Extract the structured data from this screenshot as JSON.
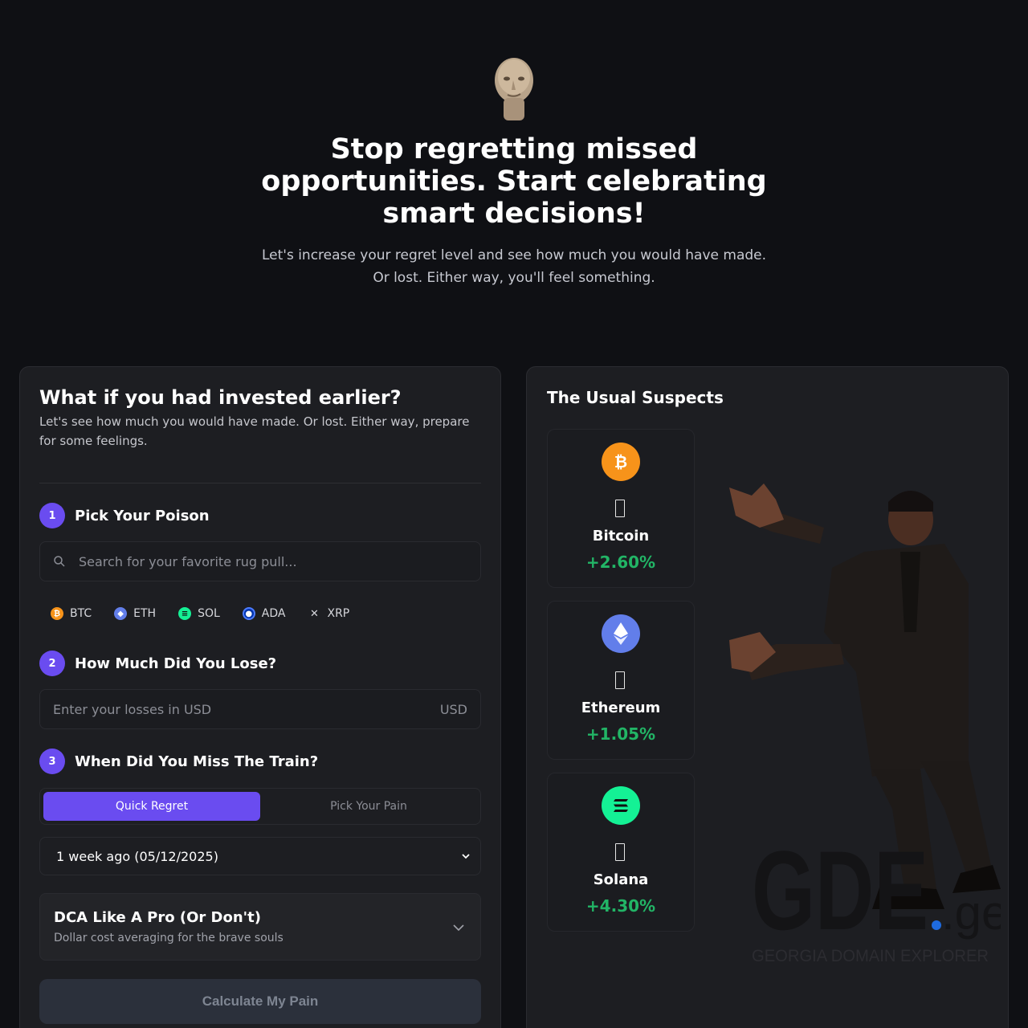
{
  "hero": {
    "title": "Stop regretting missed opportunities. Start celebrating smart decisions!",
    "subtitle": "Let's increase your regret level and see how much you would have made. Or lost. Either way, you'll feel something."
  },
  "form": {
    "title": "What if you had invested earlier?",
    "description": "Let's see how much you would have made. Or lost. Either way, prepare for some feelings.",
    "steps": [
      {
        "number": "1",
        "label": "Pick Your Poison"
      },
      {
        "number": "2",
        "label": "How Much Did You Lose?"
      },
      {
        "number": "3",
        "label": "When Did You Miss The Train?"
      }
    ],
    "search_placeholder": "Search for your favorite rug pull...",
    "coins": [
      {
        "symbol": "BTC",
        "color": "#f7931a"
      },
      {
        "symbol": "ETH",
        "color": "#627eea"
      },
      {
        "symbol": "SOL",
        "color": "#14f195"
      },
      {
        "symbol": "ADA",
        "color": "#0033ad"
      },
      {
        "symbol": "XRP",
        "color": "#23292f"
      }
    ],
    "amount_placeholder": "Enter your losses in USD",
    "amount_currency": "USD",
    "tabs": [
      {
        "label": "Quick Regret",
        "active": true
      },
      {
        "label": "Pick Your Pain",
        "active": false
      }
    ],
    "date_select": "1 week ago (05/12/2025)",
    "dca": {
      "title": "DCA Like A Pro (Or Don't)",
      "subtitle": "Dollar cost averaging for the brave souls"
    },
    "calculate_label": "Calculate My Pain"
  },
  "suspects": {
    "title": "The Usual Suspects",
    "cards": [
      {
        "name": "Bitcoin",
        "change": "+2.60%",
        "color": "#f7931a",
        "icon": "bitcoin-icon"
      },
      {
        "name": "Ethereum",
        "change": "+1.05%",
        "color": "#627eea",
        "icon": "ethereum-icon"
      },
      {
        "name": "Solana",
        "change": "+4.30%",
        "color": "#14f195",
        "icon": "solana-icon"
      }
    ]
  },
  "watermark": {
    "brand": "GDE",
    "tld": ".ge",
    "tagline": "GEORGIA DOMAIN EXPLORER"
  }
}
